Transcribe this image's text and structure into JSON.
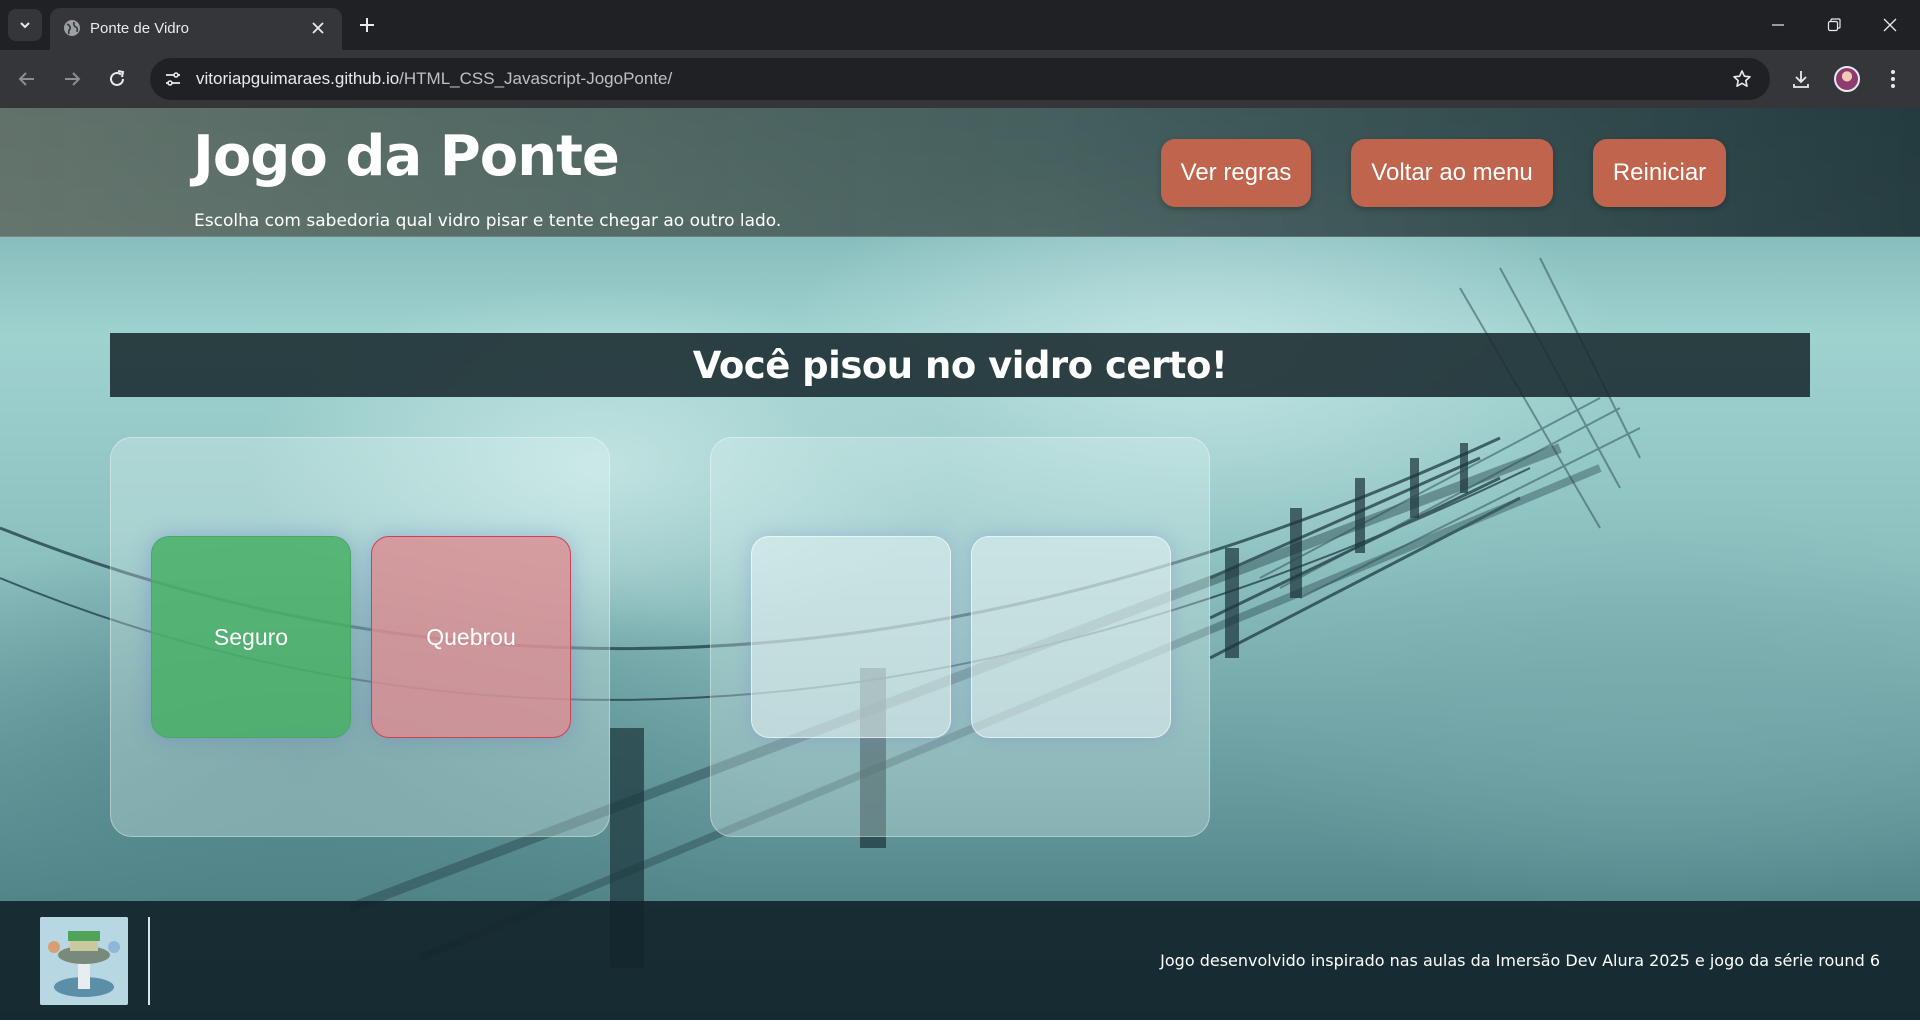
{
  "browser": {
    "tab_title": "Ponte de Vidro",
    "url_host": "vitoriapguimaraes.github.io",
    "url_path": "/HTML_CSS_Javascript-JogoPonte/"
  },
  "header": {
    "title": "Jogo da Ponte",
    "subtitle": "Escolha com sabedoria qual vidro pisar e tente chegar ao outro lado.",
    "buttons": {
      "rules": "Ver regras",
      "menu": "Voltar ao menu",
      "restart": "Reiniciar"
    },
    "button_color": "#c0644e"
  },
  "status": "Você pisou no vidro certo!",
  "steps": [
    {
      "left_glass": "Seguro",
      "right_glass": "Quebrou",
      "left_state": "safe",
      "right_state": "broken"
    },
    {
      "left_glass": "",
      "right_glass": "",
      "left_state": "unrevealed",
      "right_state": "unrevealed"
    }
  ],
  "colors": {
    "safe": "#4aa864",
    "broken": "#d04050"
  },
  "footer": {
    "credit": "Jogo desenvolvido inspirado nas aulas da Imersão Dev Alura 2025 e jogo da série round 6"
  }
}
